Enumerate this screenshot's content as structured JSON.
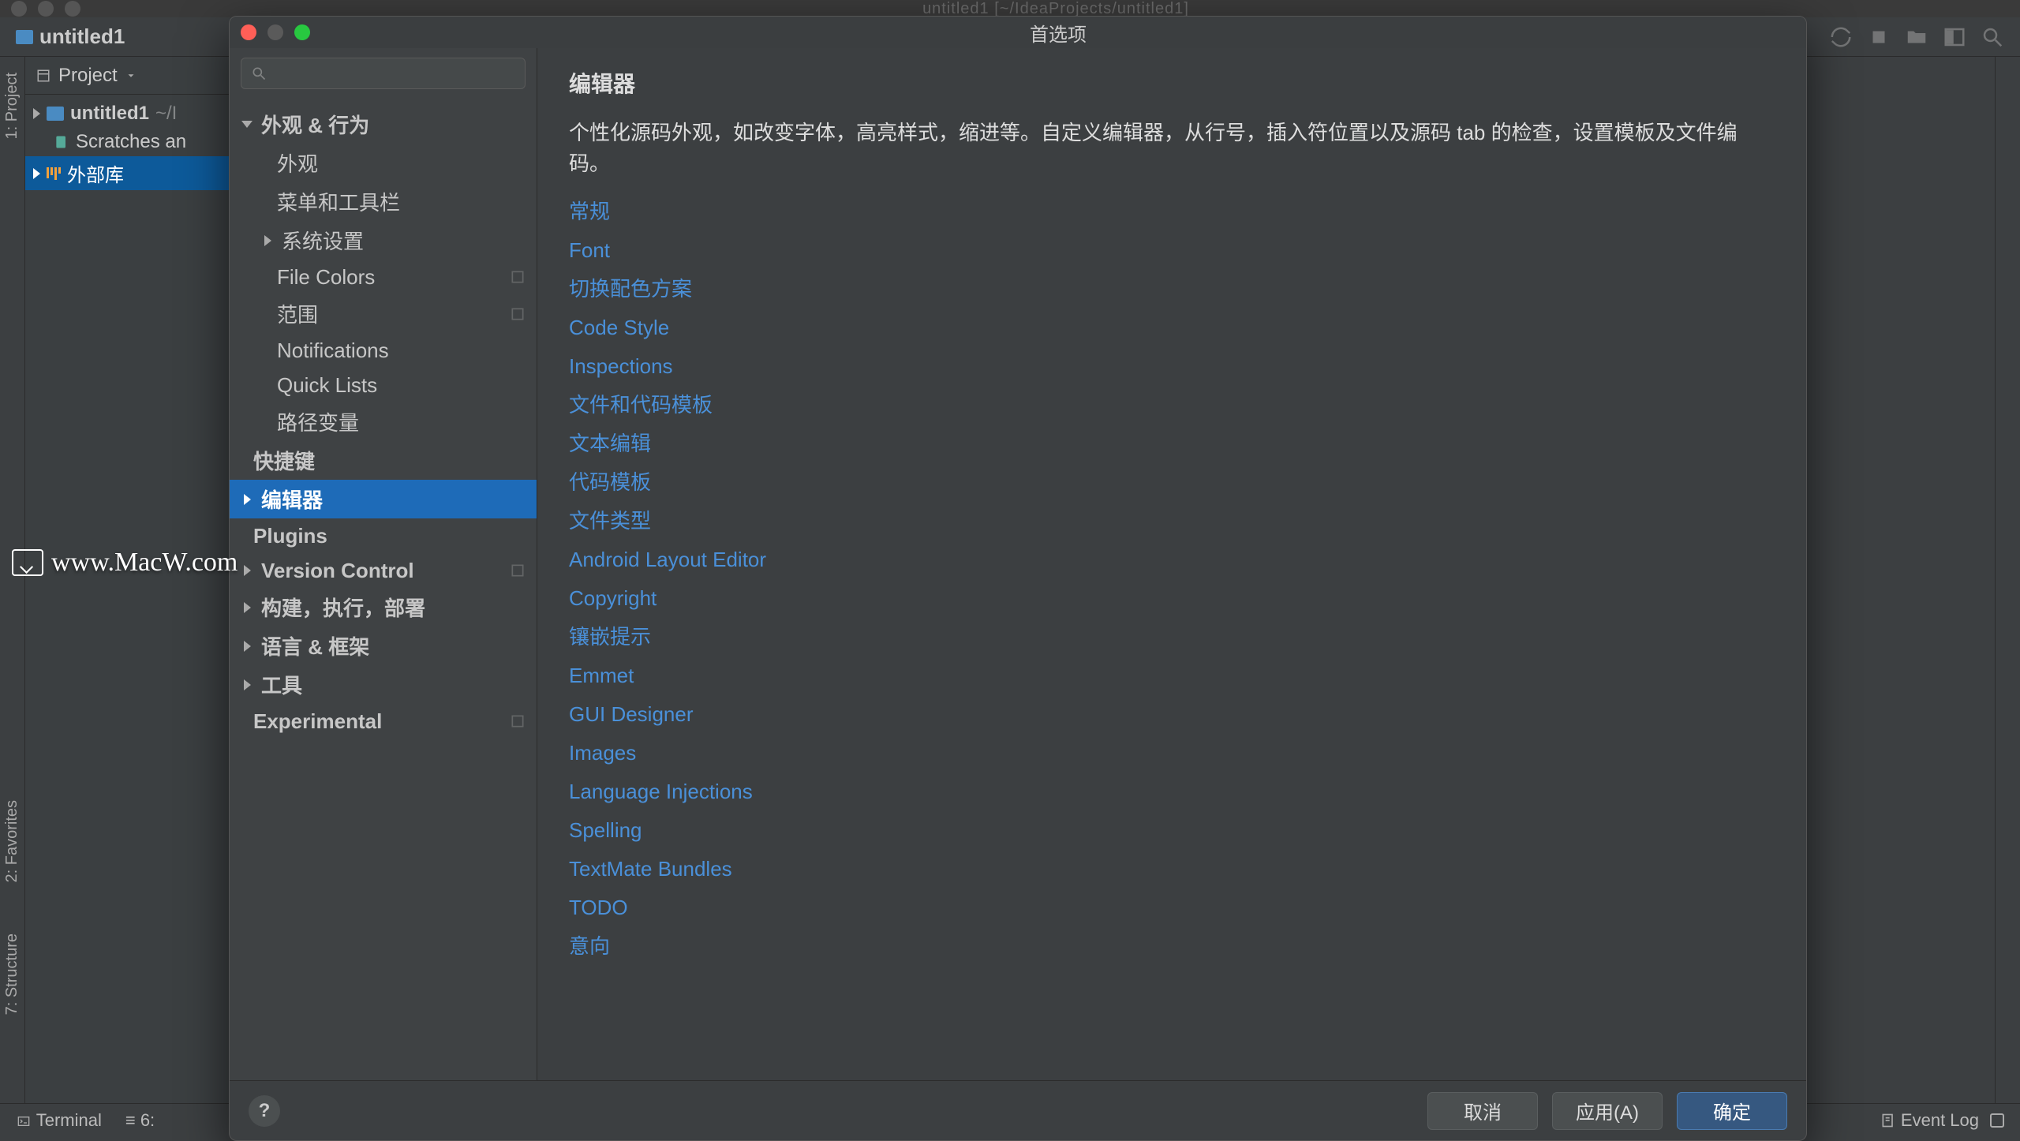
{
  "ide": {
    "titlebar": "untitled1 [~/IdeaProjects/untitled1]",
    "breadcrumb": "untitled1",
    "project_label": "Project",
    "tree": {
      "root": "untitled1",
      "root_suffix": "~/I",
      "scratches": "Scratches an",
      "external_libs": "外部库"
    },
    "left_tabs": {
      "project": "1: Project",
      "favorites": "2: Favorites",
      "structure": "7: Structure"
    },
    "statusbar": {
      "terminal": "Terminal",
      "line": "6:",
      "event_log": "Event Log"
    }
  },
  "dialog": {
    "title": "首选项",
    "search_placeholder": "",
    "tree": {
      "appearance_behavior": "外观 & 行为",
      "appearance": "外观",
      "menus_toolbars": "菜单和工具栏",
      "system_settings": "系统设置",
      "file_colors": "File Colors",
      "scopes": "范围",
      "notifications": "Notifications",
      "quick_lists": "Quick Lists",
      "path_variables": "路径变量",
      "keymap": "快捷键",
      "editor": "编辑器",
      "plugins": "Plugins",
      "version_control": "Version Control",
      "build": "构建，执行，部署",
      "languages": "语言 & 框架",
      "tools": "工具",
      "experimental": "Experimental"
    },
    "content": {
      "title": "编辑器",
      "desc": "个性化源码外观，如改变字体，高亮样式，缩进等。自定义编辑器，从行号，插入符位置以及源码 tab 的检查，设置模板及文件编码。",
      "links": [
        "常规",
        "Font",
        "切换配色方案",
        "Code Style",
        "Inspections",
        "文件和代码模板",
        "文本编辑",
        "代码模板",
        "文件类型",
        "Android Layout Editor",
        "Copyright",
        "镶嵌提示",
        "Emmet",
        "GUI Designer",
        "Images",
        "Language Injections",
        "Spelling",
        "TextMate Bundles",
        "TODO",
        "意向"
      ]
    },
    "footer": {
      "cancel": "取消",
      "apply": "应用(A)",
      "ok": "确定"
    }
  },
  "watermark": "www.MacW.com"
}
